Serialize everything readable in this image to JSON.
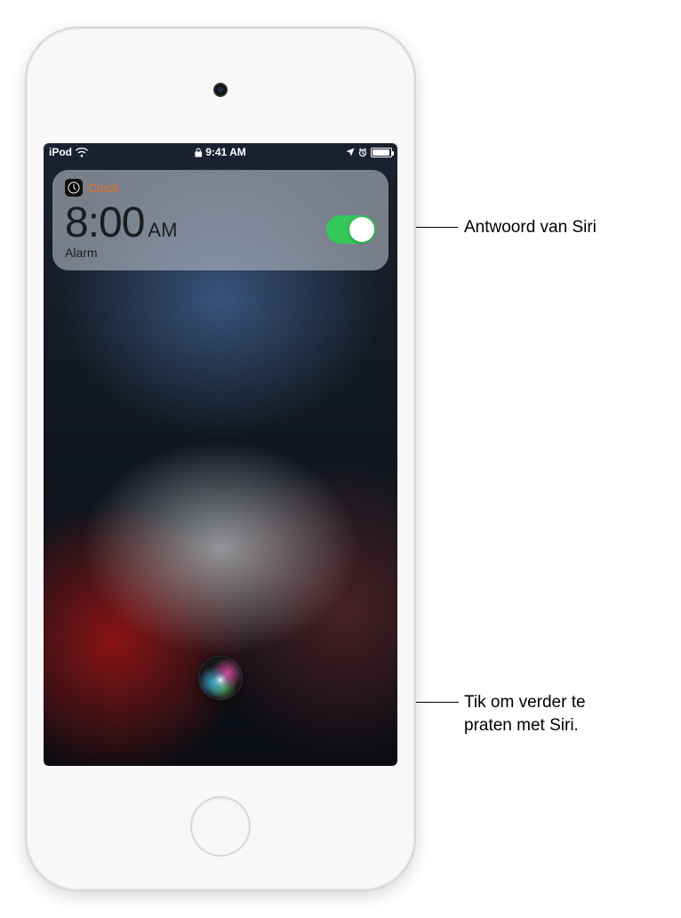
{
  "status_bar": {
    "device": "iPod",
    "time": "9:41 AM"
  },
  "notification": {
    "app_name": "Clock",
    "time_digits": "8:00",
    "time_ampm": "AM",
    "label": "Alarm",
    "toggle_on": true
  },
  "callouts": {
    "siri_response": "Antwoord van Siri",
    "tap_to_continue_line1": "Tik om verder te",
    "tap_to_continue_line2": "praten met Siri."
  }
}
